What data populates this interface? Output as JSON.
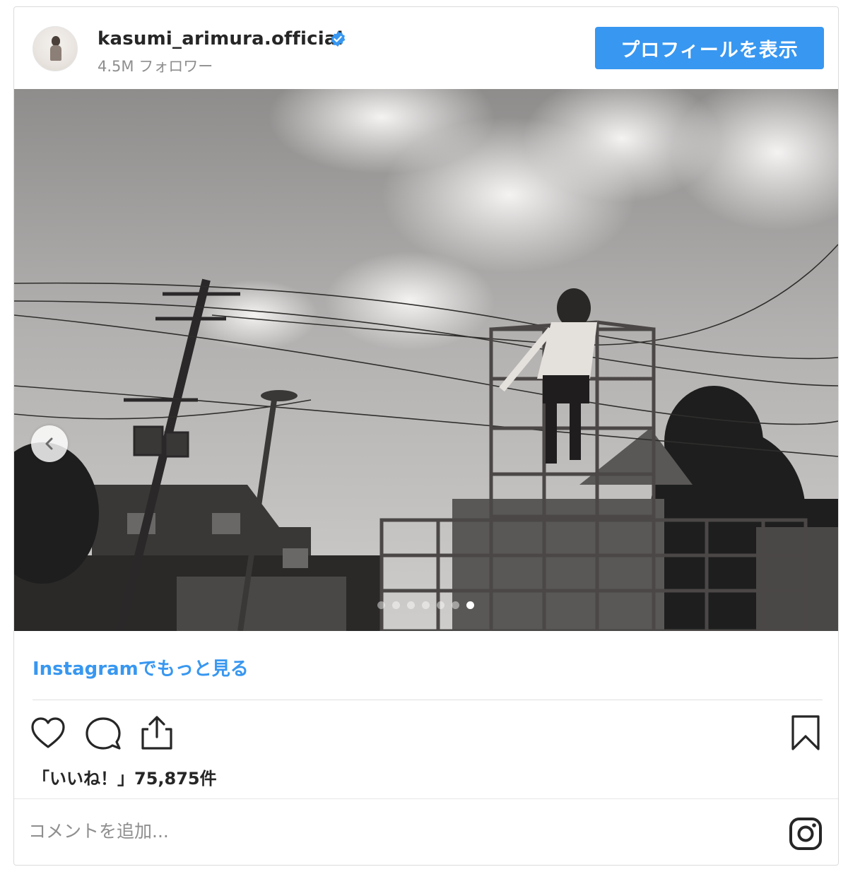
{
  "header": {
    "username": "kasumi_arimura.official",
    "followers": "4.5M フォロワー",
    "profile_button": "プロフィールを表示",
    "verified_icon": "verified-badge-icon"
  },
  "carousel": {
    "slide_count": 7,
    "active_index": 6,
    "prev_icon": "chevron-left-icon"
  },
  "more_link": "Instagramでもっと見る",
  "actions": {
    "like_icon": "heart-icon",
    "comment_icon": "comment-icon",
    "share_icon": "share-icon",
    "save_icon": "bookmark-icon"
  },
  "likes_text": "「いいね！」75,875件",
  "comment": {
    "placeholder": "コメントを追加...",
    "value": ""
  },
  "colors": {
    "accent": "#3897f0",
    "text": "#262626",
    "muted": "#8e8e8e"
  }
}
